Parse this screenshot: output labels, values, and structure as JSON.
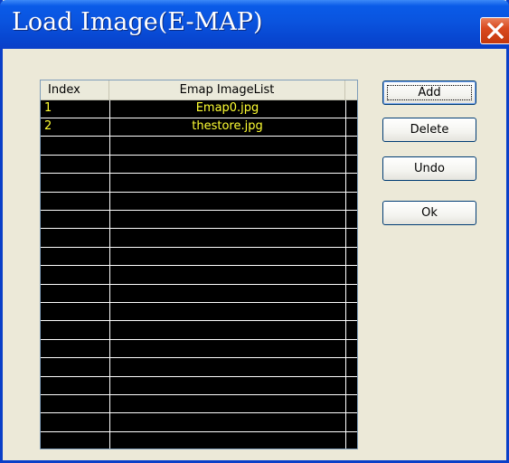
{
  "window": {
    "title": "Load Image(E-MAP)"
  },
  "list": {
    "columns": [
      "Index",
      "Emap ImageList"
    ],
    "rows": [
      {
        "index": "1",
        "name": "Emap0.jpg"
      },
      {
        "index": "2",
        "name": "thestore.jpg"
      }
    ],
    "text_color": "#ffff33",
    "background_color": "#000000"
  },
  "buttons": {
    "add": "Add",
    "delete": "Delete",
    "undo": "Undo",
    "ok": "Ok"
  },
  "colors": {
    "titlebar": "#0a55e0",
    "close_button": "#d94a1f",
    "dialog_background": "#ece9d8"
  },
  "icons": {
    "close": "close-x-icon"
  }
}
